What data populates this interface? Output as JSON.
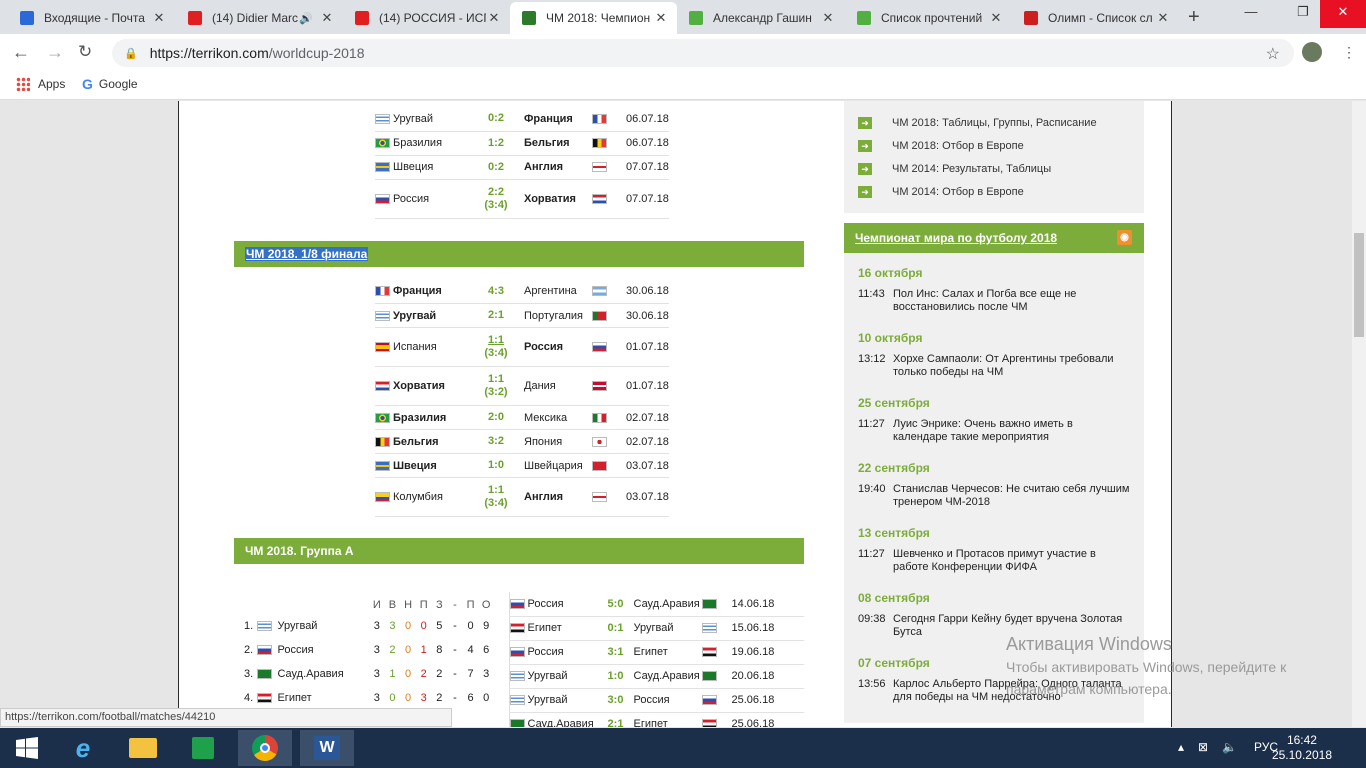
{
  "browser": {
    "tabs": [
      {
        "title": "Входящие - Почта",
        "color": "#2a6ad8",
        "active": false,
        "icon": "mail-icon"
      },
      {
        "title": "(14) Didier Marc",
        "color": "#e02020",
        "active": false,
        "icon": "youtube-icon"
      },
      {
        "title": "(14) РОССИЯ - ИСП",
        "color": "#e02020",
        "active": false,
        "icon": "youtube-icon"
      },
      {
        "title": "ЧМ 2018: Чемпион",
        "color": "#2d7a2d",
        "active": true,
        "icon": "terrikon-icon"
      },
      {
        "title": "Александр Гашин",
        "color": "#52b043",
        "active": false,
        "icon": "sheet-icon"
      },
      {
        "title": "Список прочтений",
        "color": "#52b043",
        "active": false,
        "icon": "sheet-icon"
      },
      {
        "title": "Олимп - Список сл",
        "color": "#cc2020",
        "active": false,
        "icon": "olimp-icon"
      }
    ],
    "url_host": "https://terrikon.com",
    "url_path": "/worldcup-2018",
    "bookmarks": {
      "apps": "Apps",
      "google": "Google"
    },
    "status_url": "https://terrikon.com/football/matches/44210"
  },
  "quarterfinals": [
    {
      "f1": "uy",
      "t1": "Уругвай",
      "b1": false,
      "s": "0:2",
      "p": "",
      "t2": "Франция",
      "b2": true,
      "f2": "fr",
      "d": "06.07.18"
    },
    {
      "f1": "br",
      "t1": "Бразилия",
      "b1": false,
      "s": "1:2",
      "p": "",
      "t2": "Бельгия",
      "b2": true,
      "f2": "be",
      "d": "06.07.18"
    },
    {
      "f1": "se",
      "t1": "Швеция",
      "b1": false,
      "s": "0:2",
      "p": "",
      "t2": "Англия",
      "b2": true,
      "f2": "en",
      "d": "07.07.18"
    },
    {
      "f1": "ru",
      "t1": "Россия",
      "b1": false,
      "s": "2:2",
      "p": "(3:4)",
      "t2": "Хорватия",
      "b2": true,
      "f2": "hr",
      "d": "07.07.18"
    }
  ],
  "r16_title": "ЧМ 2018. 1/8 финала",
  "r16": [
    {
      "f1": "fr",
      "t1": "Франция",
      "b1": true,
      "s": "4:3",
      "p": "",
      "t2": "Аргентина",
      "b2": false,
      "f2": "ar",
      "d": "30.06.18"
    },
    {
      "f1": "uy",
      "t1": "Уругвай",
      "b1": true,
      "s": "2:1",
      "p": "",
      "t2": "Португалия",
      "b2": false,
      "f2": "pt",
      "d": "30.06.18"
    },
    {
      "f1": "es",
      "t1": "Испания",
      "b1": false,
      "s": "1:1",
      "p": "(3:4)",
      "t2": "Россия",
      "b2": true,
      "f2": "ru",
      "d": "01.07.18",
      "link": true
    },
    {
      "f1": "hr",
      "t1": "Хорватия",
      "b1": true,
      "s": "1:1",
      "p": "(3:2)",
      "t2": "Дания",
      "b2": false,
      "f2": "dk",
      "d": "01.07.18"
    },
    {
      "f1": "br",
      "t1": "Бразилия",
      "b1": true,
      "s": "2:0",
      "p": "",
      "t2": "Мексика",
      "b2": false,
      "f2": "mx",
      "d": "02.07.18"
    },
    {
      "f1": "be",
      "t1": "Бельгия",
      "b1": true,
      "s": "3:2",
      "p": "",
      "t2": "Япония",
      "b2": false,
      "f2": "jp",
      "d": "02.07.18"
    },
    {
      "f1": "se",
      "t1": "Швеция",
      "b1": true,
      "s": "1:0",
      "p": "",
      "t2": "Швейцария",
      "b2": false,
      "f2": "ch",
      "d": "03.07.18"
    },
    {
      "f1": "co",
      "t1": "Колумбия",
      "b1": false,
      "s": "1:1",
      "p": "(3:4)",
      "t2": "Англия",
      "b2": true,
      "f2": "en",
      "d": "03.07.18"
    }
  ],
  "groupA_title": "ЧМ 2018. Группа А",
  "standings_headers": [
    "И",
    "В",
    "Н",
    "П",
    "З",
    "-",
    "П",
    "О"
  ],
  "standings": [
    {
      "pos": "1.",
      "f": "uy",
      "team": "Уругвай",
      "g": "3",
      "w": "3",
      "d": "0",
      "l": "0",
      "gf": "5",
      "sep": "-",
      "ga": "0",
      "pts": "9"
    },
    {
      "pos": "2.",
      "f": "ru",
      "team": "Россия",
      "g": "3",
      "w": "2",
      "d": "0",
      "l": "1",
      "gf": "8",
      "sep": "-",
      "ga": "4",
      "pts": "6"
    },
    {
      "pos": "3.",
      "f": "sa",
      "team": "Сауд.Аравия",
      "g": "3",
      "w": "1",
      "d": "0",
      "l": "2",
      "gf": "2",
      "sep": "-",
      "ga": "7",
      "pts": "3"
    },
    {
      "pos": "4.",
      "f": "eg",
      "team": "Египет",
      "g": "3",
      "w": "0",
      "d": "0",
      "l": "3",
      "gf": "2",
      "sep": "-",
      "ga": "6",
      "pts": "0"
    }
  ],
  "group_matches": [
    {
      "f1": "ru",
      "t1": "Россия",
      "s": "5:0",
      "t2": "Сауд.Аравия",
      "f2": "sa",
      "d": "14.06.18"
    },
    {
      "f1": "eg",
      "t1": "Египет",
      "s": "0:1",
      "t2": "Уругвай",
      "f2": "uy",
      "d": "15.06.18"
    },
    {
      "f1": "ru",
      "t1": "Россия",
      "s": "3:1",
      "t2": "Египет",
      "f2": "eg",
      "d": "19.06.18"
    },
    {
      "f1": "uy",
      "t1": "Уругвай",
      "s": "1:0",
      "t2": "Сауд.Аравия",
      "f2": "sa",
      "d": "20.06.18"
    },
    {
      "f1": "uy",
      "t1": "Уругвай",
      "s": "3:0",
      "t2": "Россия",
      "f2": "ru",
      "d": "25.06.18"
    },
    {
      "f1": "sa",
      "t1": "Сауд.Аравия",
      "s": "2:1",
      "t2": "Египет",
      "f2": "eg",
      "d": "25.06.18"
    }
  ],
  "side_links": [
    "ЧМ 2018: Таблицы, Группы, Расписание",
    "ЧМ 2018: Отбор в Европе",
    "ЧМ 2014: Результаты, Таблицы",
    "ЧМ 2014: Отбор в Европе"
  ],
  "news_title": "Чемпионат мира по футболу 2018",
  "news": [
    {
      "date": "16 октября",
      "time": "11:43",
      "text": "Пол Инс: Салах и Погба все еще не восстановились после ЧМ"
    },
    {
      "date": "10 октября",
      "time": "13:12",
      "text": "Хорхе Сампаоли: От Аргентины требовали только победы на ЧМ"
    },
    {
      "date": "25 сентября",
      "time": "11:27",
      "text": "Луис Энрике: Очень важно иметь в календаре такие мероприятия"
    },
    {
      "date": "22 сентября",
      "time": "19:40",
      "text": "Станислав Черчесов: Не считаю себя лучшим тренером ЧМ-2018"
    },
    {
      "date": "13 сентября",
      "time": "11:27",
      "text": "Шевченко и Протасов примут участие в работе Конференции ФИФА"
    },
    {
      "date": "08 сентября",
      "time": "09:38",
      "text": "Сегодня Гарри Кейну будет вручена Золотая Бутса"
    },
    {
      "date": "07 сентября",
      "time": "13:56",
      "text": "Карлос Альберто Паррейра: Одного таланта для победы на ЧМ недостаточно"
    }
  ],
  "flags": {
    "uy": "linear-gradient(#fff 0 20%,#5b8fd6 20% 40%,#fff 40% 60%,#5b8fd6 60% 80%,#fff 80%)",
    "fr": "linear-gradient(90deg,#2a4fb0 0 33%,#fff 33% 66%,#e23a3a 66%)",
    "br": "radial-gradient(circle,#2a4fb0 0 25%,#f7d117 26% 45%,#229e45 46%)",
    "be": "linear-gradient(90deg,#111 0 33%,#f7d117 33% 66%,#e23a3a 66%)",
    "se": "linear-gradient(#3b6fc2 0 40%,#f5c518 40% 60%,#3b6fc2 60%)",
    "en": "linear-gradient(#fff 0 40%,#d4202c 40% 60%,#fff 60%)",
    "ru": "linear-gradient(#fff 0 33%,#2a4fb0 33% 66%,#d4202c 66%)",
    "hr": "linear-gradient(#d4202c 0 33%,#fff 33% 66%,#2a4fb0 66%)",
    "ar": "linear-gradient(#74acdf 0 33%,#fff 33% 66%,#74acdf 66%)",
    "pt": "linear-gradient(90deg,#1b7a2a 0 40%,#d4202c 40%)",
    "es": "linear-gradient(#c60b1e 0 25%,#f7c500 25% 75%,#c60b1e 75%)",
    "dk": "linear-gradient(#c60c30 0 40%,#fff 40% 60%,#c60c30 60%)",
    "mx": "linear-gradient(90deg,#1b7a2a 0 33%,#fff 33% 66%,#d4202c 66%)",
    "jp": "radial-gradient(circle,#d4202c 0 28%,#fff 30%)",
    "ch": "linear-gradient(#d4202c,#d4202c)",
    "co": "linear-gradient(#f7d117 0 50%,#2a4fb0 50% 75%,#d4202c 75%)",
    "sa": "linear-gradient(#1b7a2a,#1b7a2a)",
    "eg": "linear-gradient(#d4202c 0 33%,#fff 33% 66%,#111 66%)"
  },
  "watermark": {
    "title": "Активация Windows",
    "line1": "Чтобы активировать Windows, перейдите к",
    "line2": "параметрам компьютера."
  },
  "taskbar": {
    "lang": "РУС",
    "time": "16:42",
    "date": "25.10.2018"
  }
}
